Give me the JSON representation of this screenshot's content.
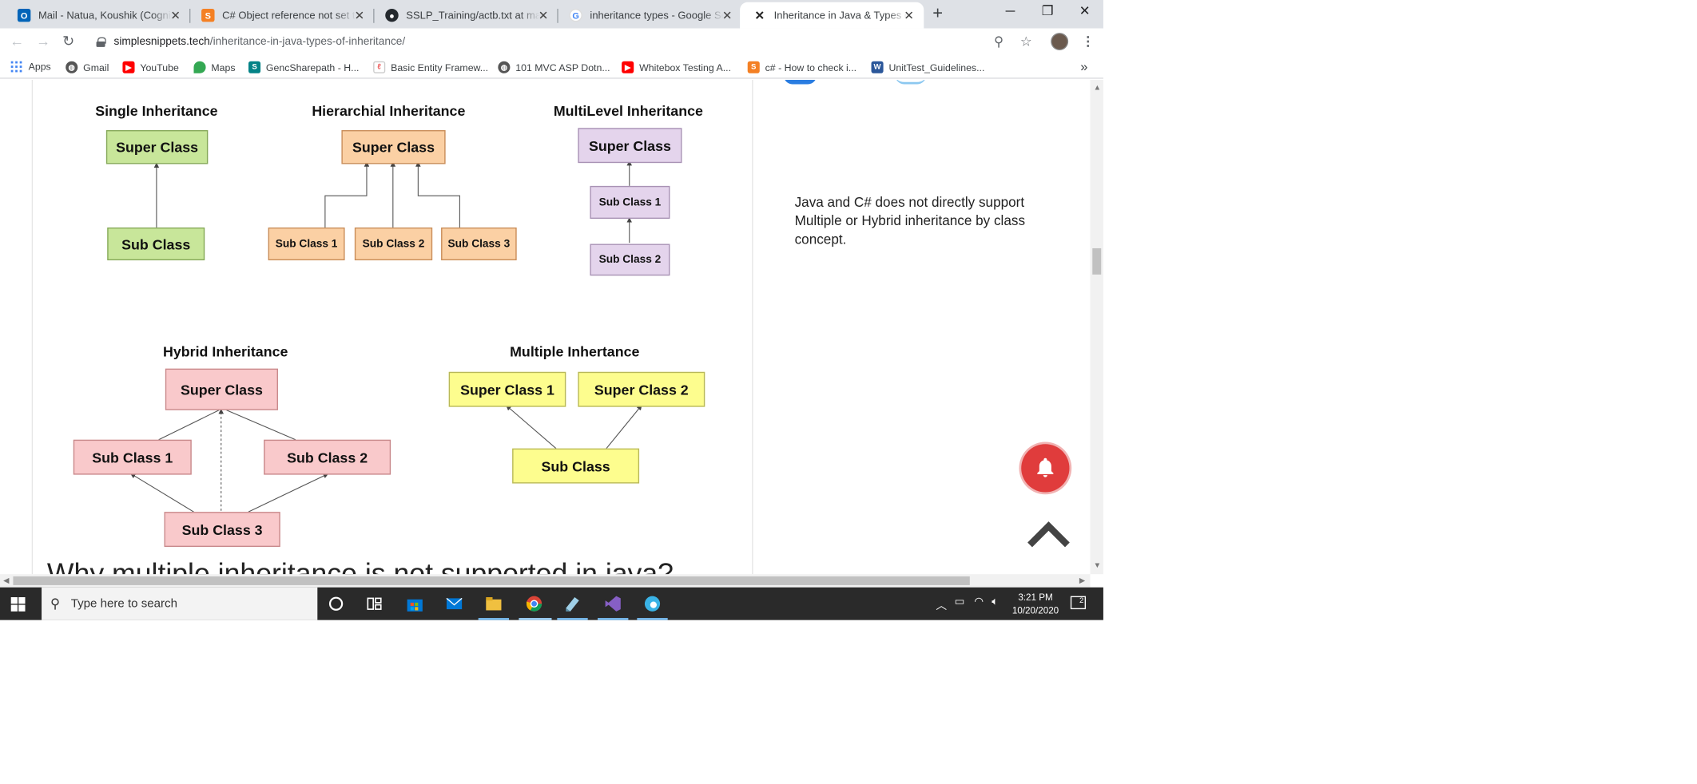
{
  "browser": {
    "tabs": [
      {
        "title": "Mail - Natua, Koushik (Cognizant)",
        "icon": "outlook-icon",
        "color": "#0364b8"
      },
      {
        "title": "C# Object reference not set to",
        "icon": "stackoverflow-icon",
        "color": "#f48024"
      },
      {
        "title": "SSLP_Training/actb.txt at master",
        "icon": "github-icon",
        "color": "#24292e"
      },
      {
        "title": "inheritance types - Google Search",
        "icon": "google-icon",
        "color": "#4285f4"
      },
      {
        "title": "Inheritance in Java & Types of",
        "icon": "simplesnippets-icon",
        "color": "#222222"
      }
    ],
    "url_host": "simplesnippets.tech",
    "url_path": "/inheritance-in-java-types-of-inheritance/",
    "bookmarks": [
      {
        "label": "Apps",
        "icon": "apps-icon",
        "color": "#4285f4"
      },
      {
        "label": "Gmail",
        "icon": "globe-icon",
        "color": "#555555"
      },
      {
        "label": "YouTube",
        "icon": "youtube-icon",
        "color": "#ff0000"
      },
      {
        "label": "Maps",
        "icon": "maps-icon",
        "color": "#34a853"
      },
      {
        "label": "GencSharepath - H...",
        "icon": "sharepoint-icon",
        "color": "#038387"
      },
      {
        "label": "Basic Entity Framew...",
        "icon": "site-icon",
        "color": "#777777"
      },
      {
        "label": "101 MVC ASP Dotn...",
        "icon": "globe-icon",
        "color": "#555555"
      },
      {
        "label": "Whitebox Testing A...",
        "icon": "youtube-icon",
        "color": "#ff0000"
      },
      {
        "label": "c# - How to check i...",
        "icon": "stackoverflow-icon",
        "color": "#f48024"
      },
      {
        "label": "UnitTest_Guidelines...",
        "icon": "word-icon",
        "color": "#2b579a"
      }
    ],
    "more_bookmarks": "»"
  },
  "page": {
    "note": "Java and C# does not directly support Multiple or Hybrid inheritance by class concept.",
    "cut_heading": "Why multiple inheritance is not supported in java?",
    "diagram": {
      "single": {
        "title": "Single Inheritance",
        "super": "Super Class",
        "sub": "Sub Class"
      },
      "hierarchical": {
        "title": "Hierarchial Inheritance",
        "super": "Super Class",
        "subs": [
          "Sub Class 1",
          "Sub Class 2",
          "Sub Class 3"
        ]
      },
      "multilevel": {
        "title": "MultiLevel Inheritance",
        "super": "Super Class",
        "sub1": "Sub Class 1",
        "sub2": "Sub Class 2"
      },
      "hybrid": {
        "title": "Hybrid Inheritance",
        "super": "Super Class",
        "sub1": "Sub Class 1",
        "sub2": "Sub Class 2",
        "sub3": "Sub Class 3"
      },
      "multiple": {
        "title": "Multiple Inhertance",
        "super1": "Super Class 1",
        "super2": "Super Class 2",
        "sub": "Sub Class"
      }
    }
  },
  "taskbar": {
    "search_placeholder": "Type here to search",
    "time": "3:21 PM",
    "date": "10/20/2020",
    "notifications": "2"
  }
}
